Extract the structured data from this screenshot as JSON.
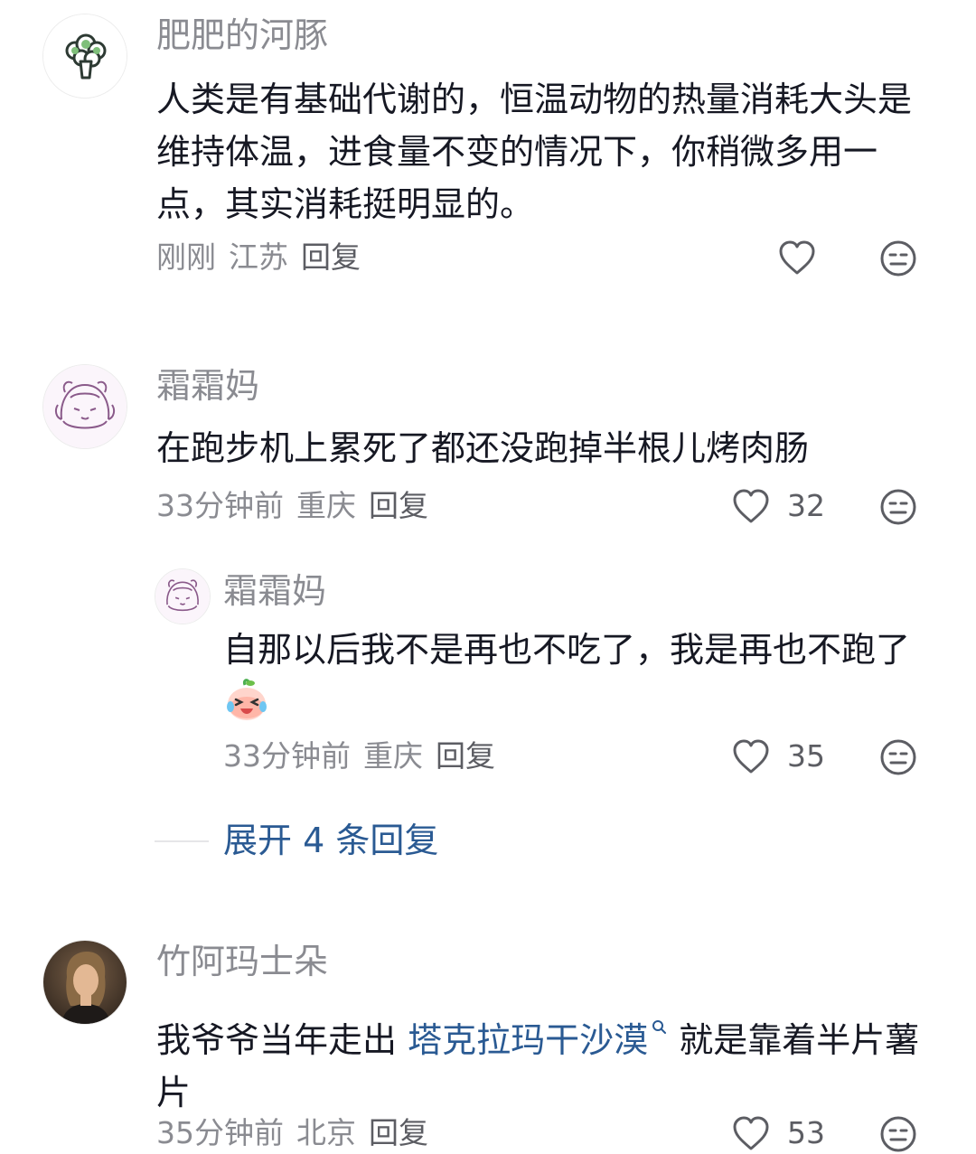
{
  "comments": [
    {
      "username": "肥肥的河豚",
      "text": "人类是有基础代谢的，恒温动物的热量消耗大头是维持体温，进食量不变的情况下，你稍微多用一点，其实消耗挺明显的。",
      "time": "刚刚",
      "location": "江苏",
      "reply_label": "回复",
      "likes": "",
      "avatar": "broccoli"
    },
    {
      "username": "霜霜妈",
      "text": "在跑步机上累死了都还没跑掉半根儿烤肉肠",
      "time": "33分钟前",
      "location": "重庆",
      "reply_label": "回复",
      "likes": "32",
      "avatar": "anime-girl-sketch",
      "replies": [
        {
          "username": "霜霜妈",
          "text": "自那以后我不是再也不吃了，我是再也不跑了",
          "emoji": "crying-laughing-peach-emoji",
          "time": "33分钟前",
          "location": "重庆",
          "reply_label": "回复",
          "likes": "35",
          "avatar": "anime-girl-sketch"
        }
      ],
      "expand_label": "展开 4 条回复"
    },
    {
      "username": "竹阿玛士朵",
      "text_before": "我爷爷当年走出 ",
      "link_text": "塔克拉玛干沙漠",
      "text_after": " 就是靠着半片薯片",
      "time": "35分钟前",
      "location": "北京",
      "reply_label": "回复",
      "likes": "53",
      "avatar": "woman-photo"
    }
  ],
  "icons": {
    "like": "heart-outline-icon",
    "dislike": "meh-face-icon",
    "search": "search-icon"
  },
  "colors": {
    "username": "#8a8b91",
    "text": "#161823",
    "link": "#2a5a93",
    "meta": "#8a8b91"
  }
}
